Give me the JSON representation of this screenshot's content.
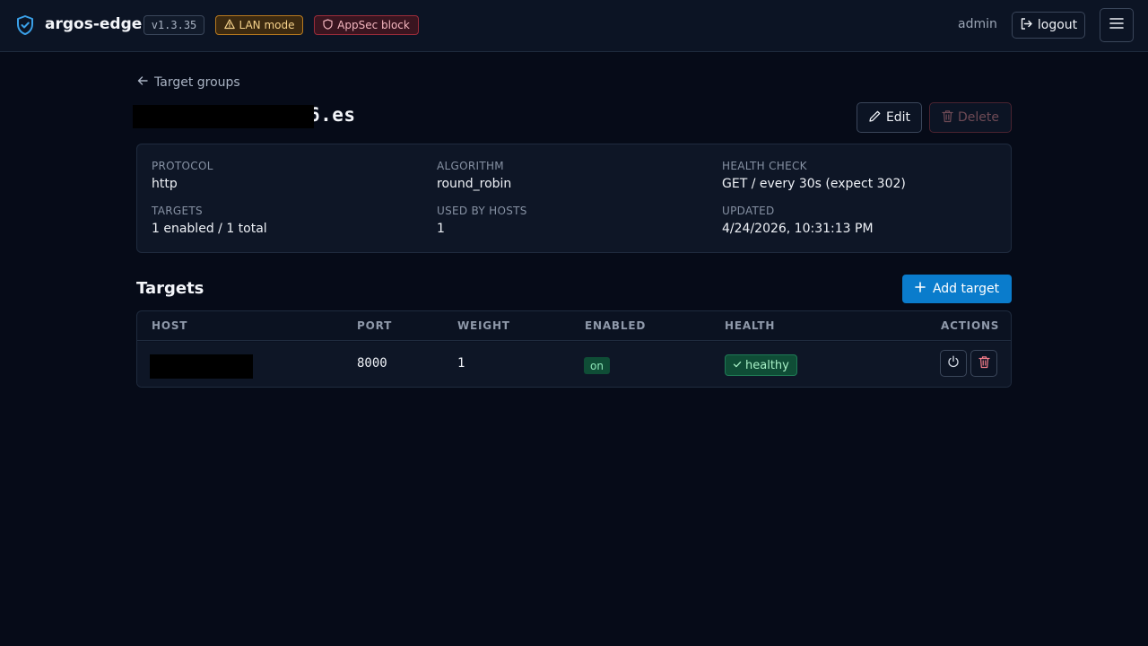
{
  "header": {
    "app_name": "argos-edge",
    "version": "v1.3.35",
    "lan_badge": "LAN mode",
    "appsec_badge": "AppSec block",
    "user": "admin",
    "logout_label": "logout",
    "icons": {
      "brand": "shield-check-icon",
      "lan": "warning-triangle-icon",
      "appsec": "shield-icon",
      "logout": "logout-icon",
      "menu": "hamburger-menu-icon"
    }
  },
  "breadcrumb": {
    "back_label": "Target groups",
    "icon": "arrow-left-icon"
  },
  "page": {
    "title_visible": "6.es",
    "edit_label": "Edit",
    "delete_label": "Delete"
  },
  "info": {
    "protocol_label": "PROTOCOL",
    "protocol_value": "http",
    "algorithm_label": "ALGORITHM",
    "algorithm_value": "round_robin",
    "health_check_label": "HEALTH CHECK",
    "health_check_value": "GET / every 30s (expect 302)",
    "targets_label": "TARGETS",
    "targets_value": "1 enabled / 1 total",
    "used_by_label": "USED BY HOSTS",
    "used_by_value": "1",
    "updated_label": "UPDATED",
    "updated_value": "4/24/2026, 10:31:13 PM"
  },
  "targets": {
    "title": "Targets",
    "add_label": "Add target",
    "columns": [
      "HOST",
      "PORT",
      "WEIGHT",
      "ENABLED",
      "HEALTH",
      "ACTIONS"
    ],
    "rows": [
      {
        "host": "",
        "port": "8000",
        "weight": "1",
        "enabled": "on",
        "health": "healthy"
      }
    ]
  },
  "colors": {
    "background": "#060b18",
    "accent": "#0a7ccc",
    "healthy": "#0f4d36",
    "danger": "#f47c8a"
  }
}
